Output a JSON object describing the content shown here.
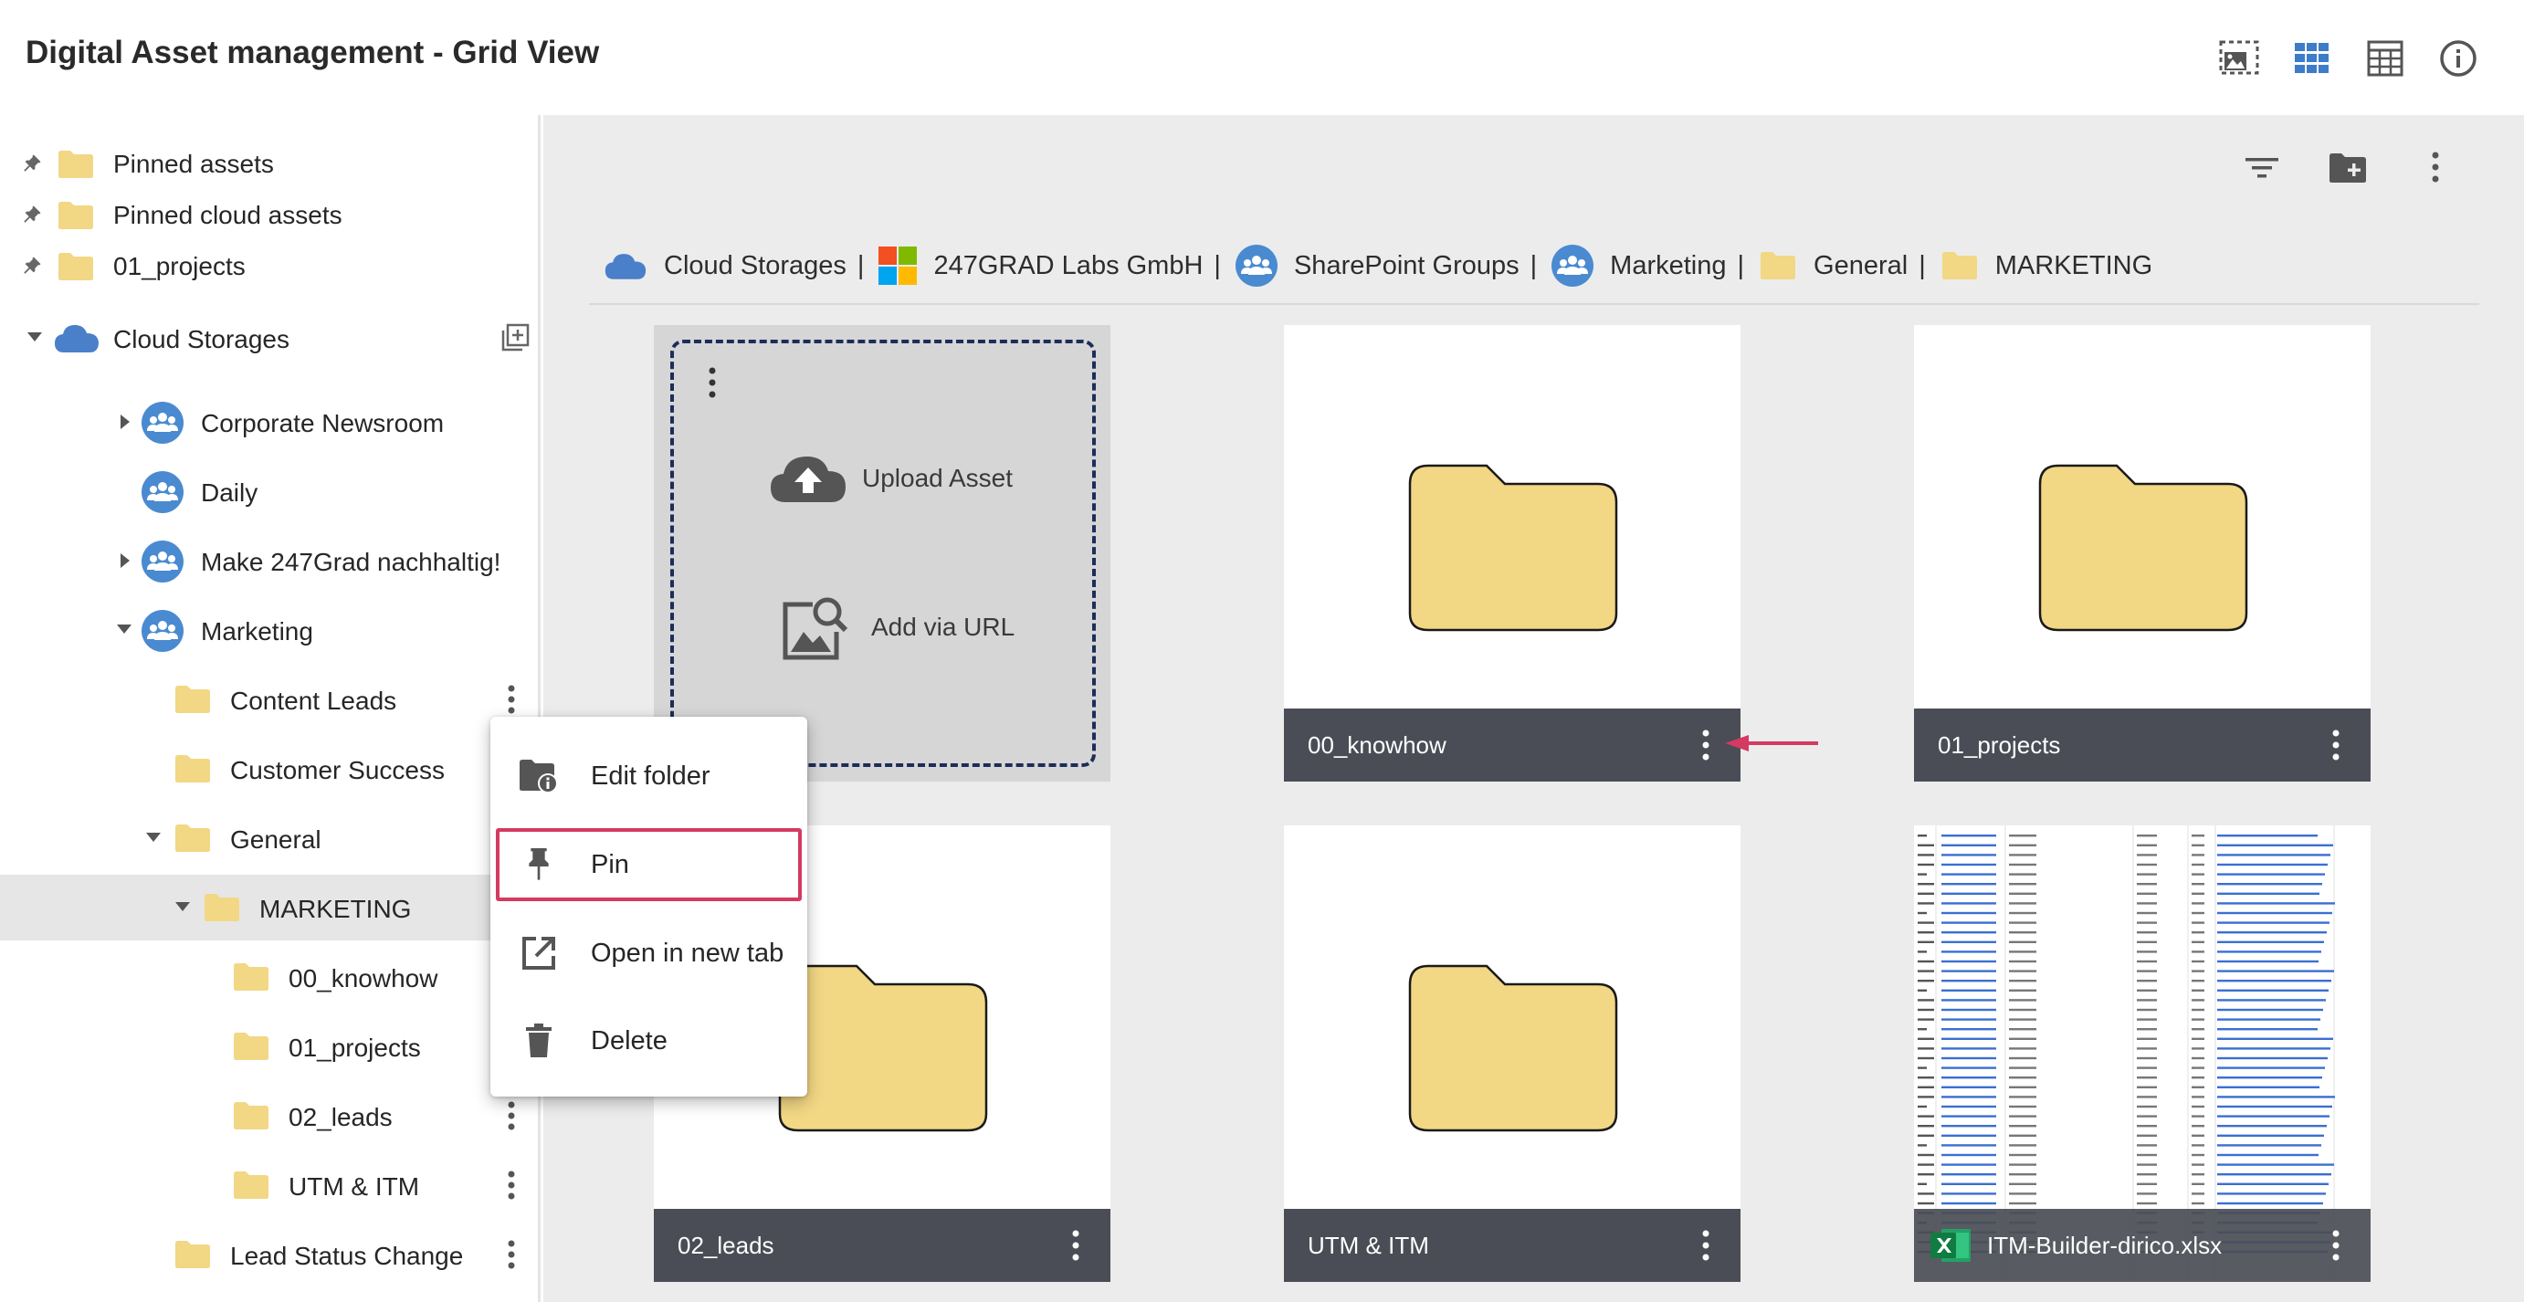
{
  "app": {
    "title": "Digital Asset management - Grid View"
  },
  "toolbar": {
    "icons": [
      "image-select-icon",
      "grid-view-icon",
      "table-view-icon",
      "info-icon"
    ],
    "main_actions": [
      "filter-icon",
      "new-folder-icon",
      "more-vert-icon"
    ]
  },
  "sidebar": {
    "pinned": [
      {
        "label": "Pinned assets"
      },
      {
        "label": "Pinned cloud assets"
      },
      {
        "label": "01_projects"
      }
    ],
    "cloud_root": {
      "label": "Cloud Storages"
    },
    "groups": [
      {
        "label": "Corporate Newsroom",
        "expandable": true,
        "expanded": false
      },
      {
        "label": "Daily",
        "expandable": false
      },
      {
        "label": "Make 247Grad nachhaltig!",
        "expandable": true,
        "expanded": false
      },
      {
        "label": "Marketing",
        "expandable": true,
        "expanded": true
      }
    ],
    "marketing_children": [
      {
        "label": "Content Leads"
      },
      {
        "label": "Customer Success"
      },
      {
        "label": "General"
      }
    ],
    "general_children": [
      {
        "label": "MARKETING",
        "selected": true
      }
    ],
    "marketing_folder_children": [
      {
        "label": "00_knowhow"
      },
      {
        "label": "01_projects"
      },
      {
        "label": "02_leads"
      },
      {
        "label": "UTM & ITM"
      }
    ],
    "after": [
      {
        "label": "Lead Status Change"
      }
    ]
  },
  "breadcrumb": [
    {
      "label": "Cloud Storages",
      "icon": "cloud-icon"
    },
    {
      "label": "247GRAD Labs GmbH",
      "icon": "microsoft-logo-icon"
    },
    {
      "label": "SharePoint Groups",
      "icon": "group-icon"
    },
    {
      "label": "Marketing",
      "icon": "group-icon"
    },
    {
      "label": "General",
      "icon": "folder-icon"
    },
    {
      "label": "MARKETING",
      "icon": "folder-icon"
    }
  ],
  "breadcrumb_separator": "|",
  "upload": {
    "upload_label": "Upload Asset",
    "url_label": "Add via URL"
  },
  "grid": {
    "items": [
      {
        "name": "00_knowhow",
        "type": "folder"
      },
      {
        "name": "01_projects",
        "type": "folder"
      },
      {
        "name": "02_leads",
        "type": "folder"
      },
      {
        "name": "UTM & ITM",
        "type": "folder"
      },
      {
        "name": "ITM-Builder-dirico.xlsx",
        "type": "xlsx"
      }
    ]
  },
  "context_menu": {
    "items": [
      {
        "label": "Edit folder",
        "icon": "folder-info-icon"
      },
      {
        "label": "Pin",
        "icon": "pin-icon",
        "highlighted": true
      },
      {
        "label": "Open in new tab",
        "icon": "open-in-new-icon"
      },
      {
        "label": "Delete",
        "icon": "trash-icon"
      }
    ]
  },
  "colors": {
    "folder": "#f2d784",
    "folder_stroke": "#1a1a1a",
    "accent_blue": "#3d7cc9",
    "group_icon_bg": "#4a8ad0",
    "caption_bg": "#4a4d55",
    "highlight": "#d43a62",
    "main_bg": "#ececec"
  }
}
